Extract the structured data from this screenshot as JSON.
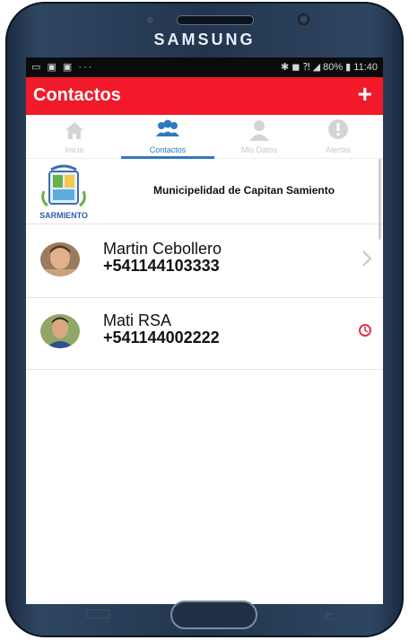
{
  "device": {
    "brand": "SAMSUNG"
  },
  "status_bar": {
    "left_icons": "▭ ▣ ▣ ···",
    "right_text": "✱ ◼ ⁈ ◢ 80% ▮ 11:40"
  },
  "app_bar": {
    "title": "Contactos",
    "add_label": "+"
  },
  "tabs": [
    {
      "label": "Inicio",
      "icon": "home-icon"
    },
    {
      "label": "Contactos",
      "icon": "contacts-icon"
    },
    {
      "label": "Mis Datos",
      "icon": "person-icon"
    },
    {
      "label": "Alertas",
      "icon": "alert-icon"
    }
  ],
  "organization": {
    "logo_text": "SARMIENTO",
    "name": "Municipelidad de Capitan Samiento"
  },
  "contacts": [
    {
      "name": "Martin Cebollero",
      "phone": "+541144103333",
      "trailing_icon": "chevron-right-icon"
    },
    {
      "name": "Mati RSA",
      "phone": "+541144002222",
      "trailing_icon": "clock-alert-icon"
    }
  ],
  "colors": {
    "accent": "#f2192a",
    "tab_active": "#2f78c2",
    "phone_body": "#22354d"
  }
}
